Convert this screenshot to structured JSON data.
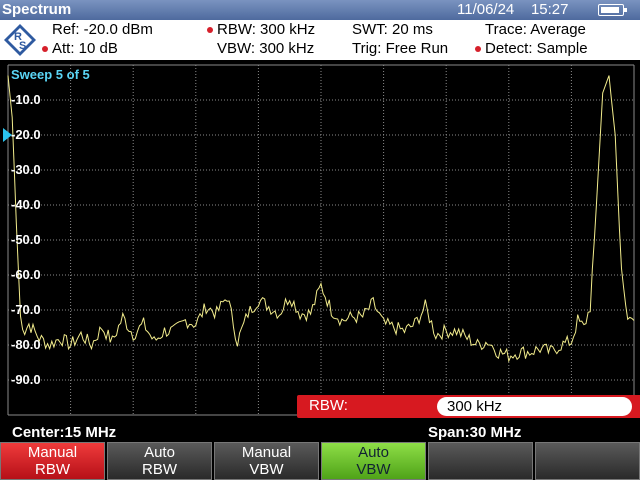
{
  "title_bar": {
    "title": "Spectrum",
    "date": "11/06/24",
    "time": "15:27",
    "battery_level": 0.9
  },
  "info": {
    "ref": "Ref:  -20.0 dBm",
    "att": "Att:  10 dB",
    "rbw": "RBW:  300 kHz",
    "vbw": "VBW:  300 kHz",
    "swt": "SWT:   20 ms",
    "trig": "Trig:   Free Run",
    "trace": "Trace:   Average",
    "detect": "Detect:  Sample"
  },
  "plot": {
    "sweep_label": "Sweep 5 of 5",
    "y_labels": [
      "-10.0",
      "-20.0",
      "-30.0",
      "-40.0",
      "-50.0",
      "-60.0",
      "-70.0",
      "-80.0",
      "-90.0"
    ],
    "trace_color": "#f2ec8c",
    "grid_color": "#8a8a8a",
    "ref_marker_color": "#2bc4ef"
  },
  "chart_data": {
    "type": "line",
    "xlim": [
      0,
      30
    ],
    "ylim": [
      -100,
      0
    ],
    "x_unit": "MHz",
    "y_unit": "dBm",
    "x": [
      0.0,
      0.2,
      0.4,
      0.6,
      0.8,
      1.0,
      1.5,
      2.0,
      2.5,
      3.0,
      3.5,
      4.0,
      4.5,
      5.0,
      5.5,
      6.0,
      6.5,
      7.0,
      7.5,
      8.0,
      8.5,
      9.0,
      9.5,
      10.0,
      10.5,
      11.0,
      11.5,
      12.0,
      12.5,
      13.0,
      13.5,
      14.0,
      14.5,
      15.0,
      15.5,
      16.0,
      16.5,
      17.0,
      17.5,
      18.0,
      18.5,
      19.0,
      19.5,
      20.0,
      20.5,
      21.0,
      21.5,
      22.0,
      22.5,
      23.0,
      23.5,
      24.0,
      24.5,
      25.0,
      25.5,
      26.0,
      26.5,
      27.0,
      27.3,
      27.6,
      27.9,
      28.2,
      28.5,
      28.8,
      29.1,
      29.4,
      29.7,
      30.0
    ],
    "y": [
      -3,
      -15,
      -45,
      -72,
      -76,
      -74,
      -78,
      -80,
      -78,
      -80,
      -77,
      -80,
      -75,
      -79,
      -72,
      -77,
      -74,
      -79,
      -76,
      -76,
      -73,
      -74,
      -69,
      -71,
      -66,
      -79,
      -71,
      -67,
      -69,
      -71,
      -66,
      -71,
      -71,
      -63,
      -70,
      -73,
      -72,
      -72,
      -68,
      -74,
      -75,
      -76,
      -74,
      -69,
      -77,
      -76,
      -76,
      -78,
      -80,
      -79,
      -82,
      -83,
      -82,
      -82,
      -81,
      -82,
      -80,
      -79,
      -73,
      -75,
      -69,
      -40,
      -8,
      -3,
      -20,
      -60,
      -72,
      -73
    ]
  },
  "rbw_input": {
    "label": "RBW:",
    "value": "300 kHz"
  },
  "status": {
    "center": "Center:15 MHz",
    "span": "Span:30 MHz"
  },
  "softkeys": [
    {
      "line1": "Manual",
      "line2": "RBW"
    },
    {
      "line1": "Auto",
      "line2": "RBW"
    },
    {
      "line1": "Manual",
      "line2": "VBW"
    },
    {
      "line1": "Auto",
      "line2": "VBW"
    },
    {
      "line1": "",
      "line2": ""
    },
    {
      "line1": "",
      "line2": ""
    }
  ]
}
